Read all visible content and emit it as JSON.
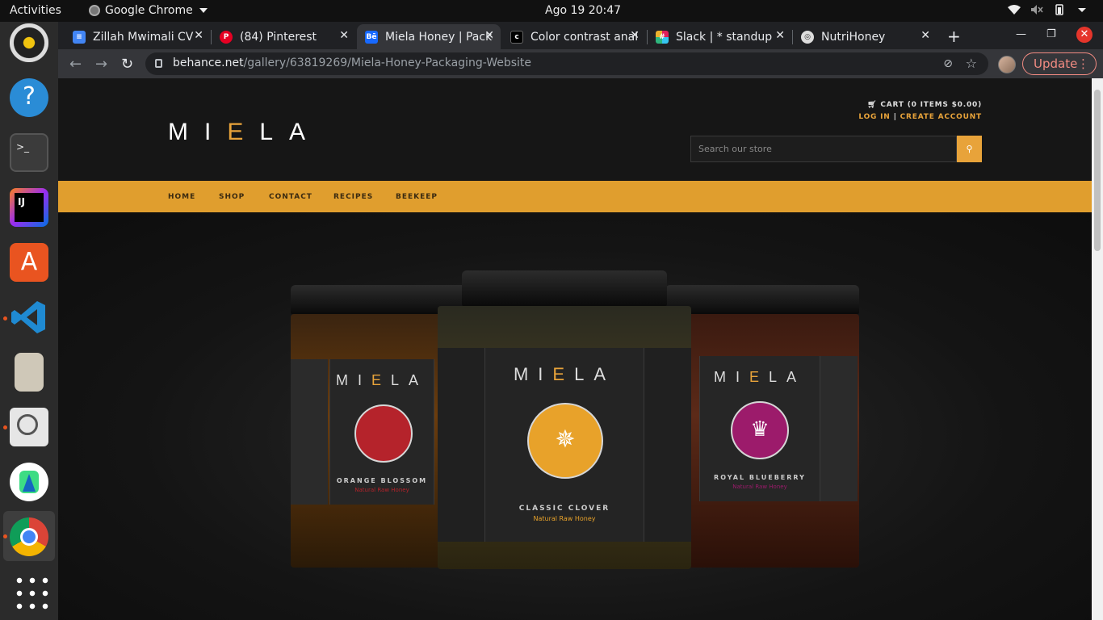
{
  "topbar": {
    "activities": "Activities",
    "app_name": "Google Chrome",
    "clock": "Ago 19  20:47"
  },
  "dock": {
    "apps": [
      "rhythmbox-icon",
      "help-icon",
      "terminal-icon",
      "intellij-icon",
      "app-center-icon",
      "vscode-icon",
      "archive-icon",
      "screenshot-icon",
      "android-studio-icon",
      "chrome-icon",
      "app-grid-icon"
    ]
  },
  "tabs": [
    {
      "title": "Zillah Mwimali CV",
      "icon": "docs-icon",
      "color": "#4285f4"
    },
    {
      "title": "(84) Pinterest",
      "icon": "pinterest-icon",
      "color": "#e60023"
    },
    {
      "title": "Miela Honey | Packaging",
      "icon": "behance-icon",
      "color": "#1769ff"
    },
    {
      "title": "Color contrast analyzer",
      "icon": "contrast-icon",
      "color": "#202124"
    },
    {
      "title": "Slack | * standup",
      "icon": "slack-icon",
      "color": "#4a154b"
    },
    {
      "title": "NutriHoney",
      "icon": "globe-icon",
      "color": "#9aa0a6"
    }
  ],
  "address": {
    "domain": "behance.net",
    "path": "/gallery/63819269/Miela-Honey-Packaging-Website",
    "update_label": "Update"
  },
  "site": {
    "logo_pre": "MI",
    "logo_e": "E",
    "logo_post": "LA",
    "cart": "CART (0 ITEMS $0.00)",
    "login": "LOG IN",
    "separator": "|",
    "create_account": "CREATE ACCOUNT",
    "search_placeholder": "Search our store",
    "nav": [
      "HOME",
      "SHOP",
      "CONTACT",
      "RECIPES",
      "BEEKEEP"
    ],
    "accent": "#e09e2e"
  },
  "jars": {
    "left": {
      "variety": "ORANGE BLOSSOM",
      "sub": "Natural Raw Honey",
      "emblem_color": "#b5232b"
    },
    "center": {
      "variety": "CLASSIC CLOVER",
      "sub": "Natural Raw Honey",
      "emblem_color": "#e8a22a"
    },
    "right": {
      "variety": "ROYAL BLUEBERRY",
      "sub": "Natural Raw Honey",
      "emblem_color": "#9c1b6b"
    }
  }
}
